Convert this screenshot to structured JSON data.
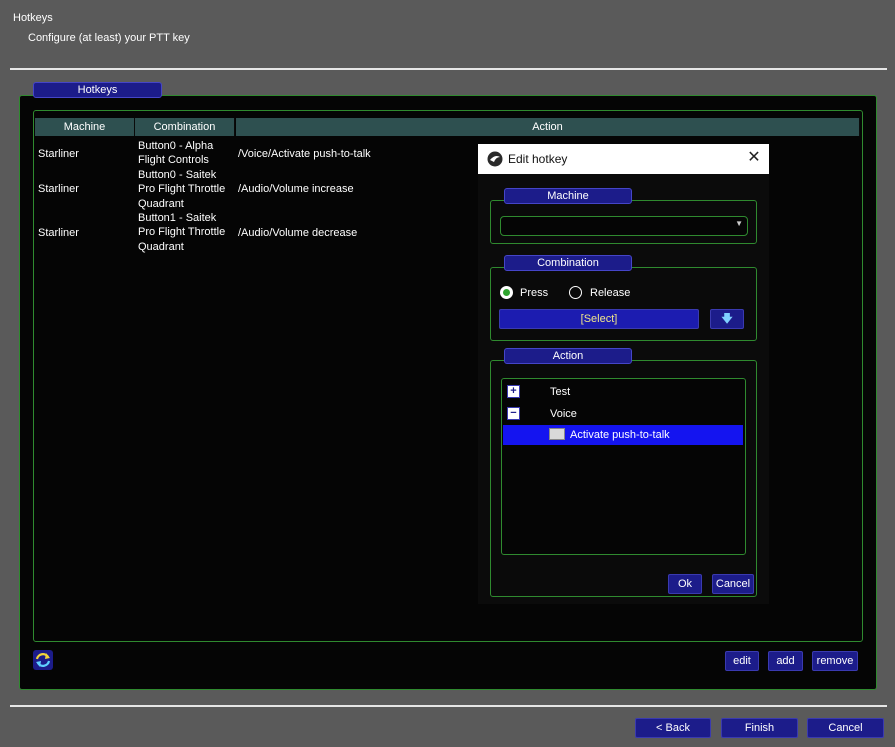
{
  "wizard": {
    "title": "Hotkeys",
    "subtitle": "Configure (at least) your PTT key"
  },
  "panel": {
    "legend": "Hotkeys"
  },
  "table": {
    "columns": [
      "Machine",
      "Combination",
      "Action"
    ],
    "rows": [
      {
        "machine": "Starliner",
        "combination": "Button0 - Alpha Flight Controls",
        "action": "/Voice/Activate push-to-talk"
      },
      {
        "machine": "Starliner",
        "combination": "Button0 - Saitek Pro Flight Throttle Quadrant",
        "action": "/Audio/Volume increase"
      },
      {
        "machine": "Starliner",
        "combination": "Button1 - Saitek Pro Flight Throttle Quadrant",
        "action": "/Audio/Volume decrease"
      }
    ]
  },
  "row_buttons": {
    "edit": "edit",
    "add": "add",
    "remove": "remove"
  },
  "dialog": {
    "title": "Edit hotkey",
    "machine_legend": "Machine",
    "machine_value": "",
    "combination_legend": "Combination",
    "press_label": "Press",
    "release_label": "Release",
    "select_label": "[Select]",
    "action_legend": "Action",
    "tree": [
      {
        "label": "Test",
        "expander": "+"
      },
      {
        "label": "Voice",
        "expander": "−"
      },
      {
        "label": "Activate push-to-talk",
        "selected": true
      }
    ],
    "ok": "Ok",
    "cancel": "Cancel"
  },
  "footer": {
    "back": "< Back",
    "finish": "Finish",
    "cancel": "Cancel"
  },
  "colors": {
    "accent_blue": "#1c1c8a",
    "selection_blue": "#1414f0",
    "border_green": "#2f8a2f",
    "header_teal": "#2e5050"
  }
}
